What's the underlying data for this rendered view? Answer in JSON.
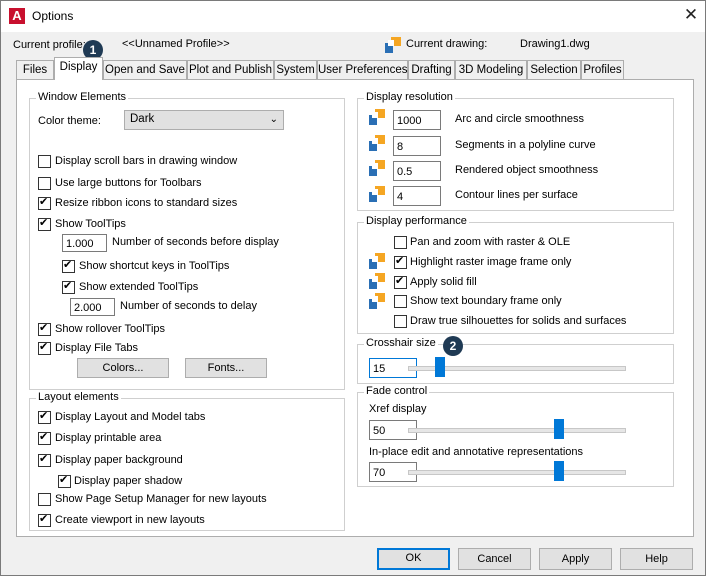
{
  "window": {
    "title": "Options",
    "close": "✕",
    "app_icon": "A"
  },
  "profile": {
    "label": "Current profile:",
    "value": "<<Unnamed Profile>>"
  },
  "drawing": {
    "label": "Current drawing:",
    "value": "Drawing1.dwg"
  },
  "badges": {
    "one": "1",
    "two": "2"
  },
  "tabs": [
    "Files",
    "Display",
    "Open and Save",
    "Plot and Publish",
    "System",
    "User Preferences",
    "Drafting",
    "3D Modeling",
    "Selection",
    "Profiles"
  ],
  "active_tab": "Display",
  "window_elements": {
    "title": "Window Elements",
    "color_theme_label": "Color theme:",
    "color_theme_value": "Dark",
    "scroll_bars": {
      "label": "Display scroll bars in drawing window",
      "checked": false
    },
    "large_buttons": {
      "label": "Use large buttons for Toolbars",
      "checked": false
    },
    "resize_ribbon": {
      "label": "Resize ribbon icons to standard sizes",
      "checked": true
    },
    "show_tooltips": {
      "label": "Show ToolTips",
      "checked": true
    },
    "seconds_before_display": {
      "value": "1.000",
      "label": "Number of seconds before display"
    },
    "shortcut_keys": {
      "label": "Show shortcut keys in ToolTips",
      "checked": true
    },
    "extended_tooltips": {
      "label": "Show extended ToolTips",
      "checked": true
    },
    "seconds_to_delay": {
      "value": "2.000",
      "label": "Number of seconds to delay"
    },
    "rollover_tooltips": {
      "label": "Show rollover ToolTips",
      "checked": true
    },
    "file_tabs": {
      "label": "Display File Tabs",
      "checked": true
    },
    "colors_button": "Colors...",
    "fonts_button": "Fonts..."
  },
  "layout_elements": {
    "title": "Layout elements",
    "layout_model_tabs": {
      "label": "Display Layout and Model tabs",
      "checked": true
    },
    "printable_area": {
      "label": "Display printable area",
      "checked": true
    },
    "paper_background": {
      "label": "Display paper background",
      "checked": true
    },
    "paper_shadow": {
      "label": "Display paper shadow",
      "checked": true
    },
    "page_setup_manager": {
      "label": "Show Page Setup Manager for new layouts",
      "checked": false
    },
    "create_viewport": {
      "label": "Create viewport in new layouts",
      "checked": true
    }
  },
  "display_resolution": {
    "title": "Display resolution",
    "arc_smoothness": {
      "value": "1000",
      "label": "Arc and circle smoothness"
    },
    "polyline_segments": {
      "value": "8",
      "label": "Segments in a polyline curve"
    },
    "rendered_smoothness": {
      "value": "0.5",
      "label": "Rendered object smoothness"
    },
    "contour_lines": {
      "value": "4",
      "label": "Contour lines per surface"
    }
  },
  "display_performance": {
    "title": "Display performance",
    "pan_zoom": {
      "label": "Pan and zoom with raster & OLE",
      "checked": false
    },
    "highlight_raster": {
      "label": "Highlight raster image frame only",
      "checked": true
    },
    "solid_fill": {
      "label": "Apply solid fill",
      "checked": true
    },
    "text_boundary": {
      "label": "Show text boundary frame only",
      "checked": false
    },
    "silhouettes": {
      "label": "Draw true silhouettes for solids and surfaces",
      "checked": false
    }
  },
  "crosshair": {
    "title": "Crosshair size",
    "value": "15",
    "level_percent": 15
  },
  "fade_control": {
    "title": "Fade control",
    "xref_label": "Xref display",
    "xref_value": "50",
    "xref_level_percent": 70,
    "inplace_label": "In-place edit and annotative representations",
    "inplace_value": "70",
    "inplace_level_percent": 70
  },
  "footer": {
    "ok": "OK",
    "cancel": "Cancel",
    "apply": "Apply",
    "help": "Help"
  },
  "colors": {
    "accent": "#0078d7",
    "badge": "#1f3a54",
    "app_icon": "#c8102e"
  }
}
